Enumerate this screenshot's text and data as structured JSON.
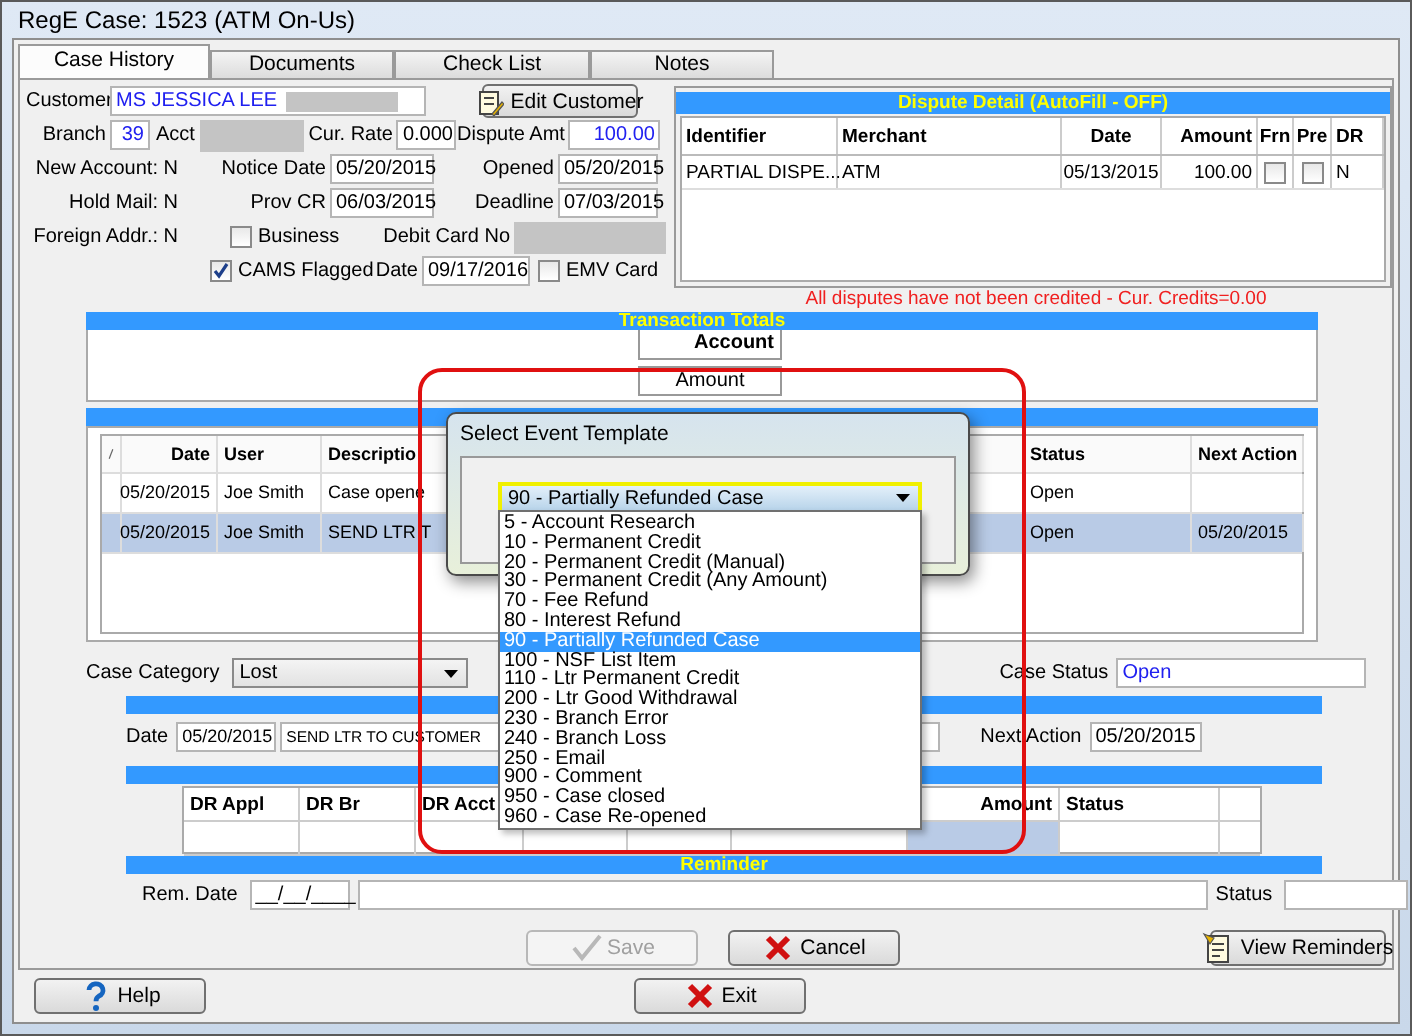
{
  "window": {
    "title": "RegE Case: 1523 (ATM On-Us)"
  },
  "tabs": [
    {
      "label": "Case History",
      "selected": true
    },
    {
      "label": "Documents",
      "selected": false
    },
    {
      "label": "Check List",
      "selected": false
    },
    {
      "label": "Notes",
      "selected": false
    }
  ],
  "customer": {
    "customer_label": "Customer",
    "customer_name": "MS JESSICA LEE",
    "edit_button": "Edit Customer",
    "branch_label": "Branch",
    "branch": "39",
    "acct_label": "Acct",
    "cur_rate_label": "Cur. Rate",
    "cur_rate": "0.000",
    "dispute_amt_label": "Dispute Amt",
    "dispute_amt": "100.00",
    "new_account": "New Account: N",
    "notice_date_label": "Notice Date",
    "notice_date": "05/20/2015",
    "opened_label": "Opened",
    "opened": "05/20/2015",
    "hold_mail": "Hold Mail: N",
    "prov_cr_label": "Prov CR",
    "prov_cr": "06/03/2015",
    "deadline_label": "Deadline",
    "deadline": "07/03/2015",
    "foreign_addr": "Foreign Addr.: N",
    "debit_card_label": "Debit Card No",
    "cams_date_label": "Date",
    "cams_date": "09/17/2016"
  },
  "checkboxes": [
    {
      "label": "Business",
      "checked": false
    },
    {
      "label": "CAMS Flagged",
      "checked": true
    },
    {
      "label": "EMV Card",
      "checked": false
    }
  ],
  "dispute_detail": {
    "title": "Dispute Detail (AutoFill - OFF)",
    "columns": [
      "Identifier",
      "Merchant",
      "Date",
      "Amount",
      "Frn",
      "Pre",
      "DR"
    ],
    "rows": [
      {
        "identifier": "PARTIAL DISPE...",
        "merchant": "ATM",
        "date": "05/13/2015",
        "amount": "100.00",
        "frn": false,
        "pre": false,
        "dr": "N"
      }
    ],
    "message": "All disputes have not been credited - Cur. Credits=0.00"
  },
  "transaction_totals": {
    "title": "Transaction Totals",
    "column": "Account",
    "row_label": "Amount"
  },
  "events": {
    "columns": [
      "Date",
      "User",
      "Descriptio",
      "Status",
      "Next Action"
    ],
    "rows": [
      {
        "date": "05/20/2015",
        "user": "Joe Smith",
        "description": "Case opene",
        "status": "Open",
        "selected": false
      },
      {
        "date": "05/20/2015",
        "user": "Joe Smith",
        "description": "SEND LTR T",
        "status": "Open",
        "next_action": "05/20/2015",
        "selected": true
      }
    ]
  },
  "case": {
    "category_label": "Case Category",
    "category": "Lost",
    "status_label": "Case Status",
    "status": "Open"
  },
  "event_detail": {
    "date_label": "Date",
    "date": "05/20/2015",
    "description": "SEND LTR TO CUSTOMER",
    "next_action_label": "Next Action",
    "next_action": "05/20/2015"
  },
  "dr_table": {
    "columns": [
      "DR Appl",
      "DR Br",
      "DR Acct",
      "Amount",
      "Status"
    ]
  },
  "reminder": {
    "title": "Reminder",
    "date_label": "Rem. Date",
    "date": "__/__/____",
    "status_label": "Status"
  },
  "buttons": [
    {
      "kind": "save",
      "label": "Save",
      "disabled": true
    },
    {
      "kind": "cancel",
      "label": "Cancel",
      "disabled": false
    },
    {
      "kind": "view_reminders",
      "label": "View Reminders",
      "disabled": false
    },
    {
      "kind": "help",
      "label": "Help",
      "disabled": false
    },
    {
      "kind": "exit",
      "label": "Exit",
      "disabled": false
    }
  ],
  "dialog": {
    "title": "Select Event Template",
    "value": "90 - Partially Refunded Case",
    "options": [
      {
        "label": "5 - Account Research",
        "selected": false
      },
      {
        "label": "10 - Permanent Credit",
        "selected": false
      },
      {
        "label": "20 - Permanent Credit (Manual)",
        "selected": false
      },
      {
        "label": "30 - Permanent Credit (Any Amount)",
        "selected": false
      },
      {
        "label": "70 - Fee Refund",
        "selected": false
      },
      {
        "label": "80 - Interest Refund",
        "selected": false
      },
      {
        "label": "90 - Partially Refunded Case",
        "selected": true
      },
      {
        "label": "100 - NSF List Item",
        "selected": false
      },
      {
        "label": "110 - Ltr Permanent Credit",
        "selected": false
      },
      {
        "label": "200 - Ltr Good Withdrawal",
        "selected": false
      },
      {
        "label": "230 - Branch Error",
        "selected": false
      },
      {
        "label": "240 - Branch Loss",
        "selected": false
      },
      {
        "label": "250 - Email",
        "selected": false
      },
      {
        "label": "900 - Comment",
        "selected": false
      },
      {
        "label": "950 - Case closed",
        "selected": false
      },
      {
        "label": "960 - Case Re-opened",
        "selected": false
      }
    ]
  }
}
